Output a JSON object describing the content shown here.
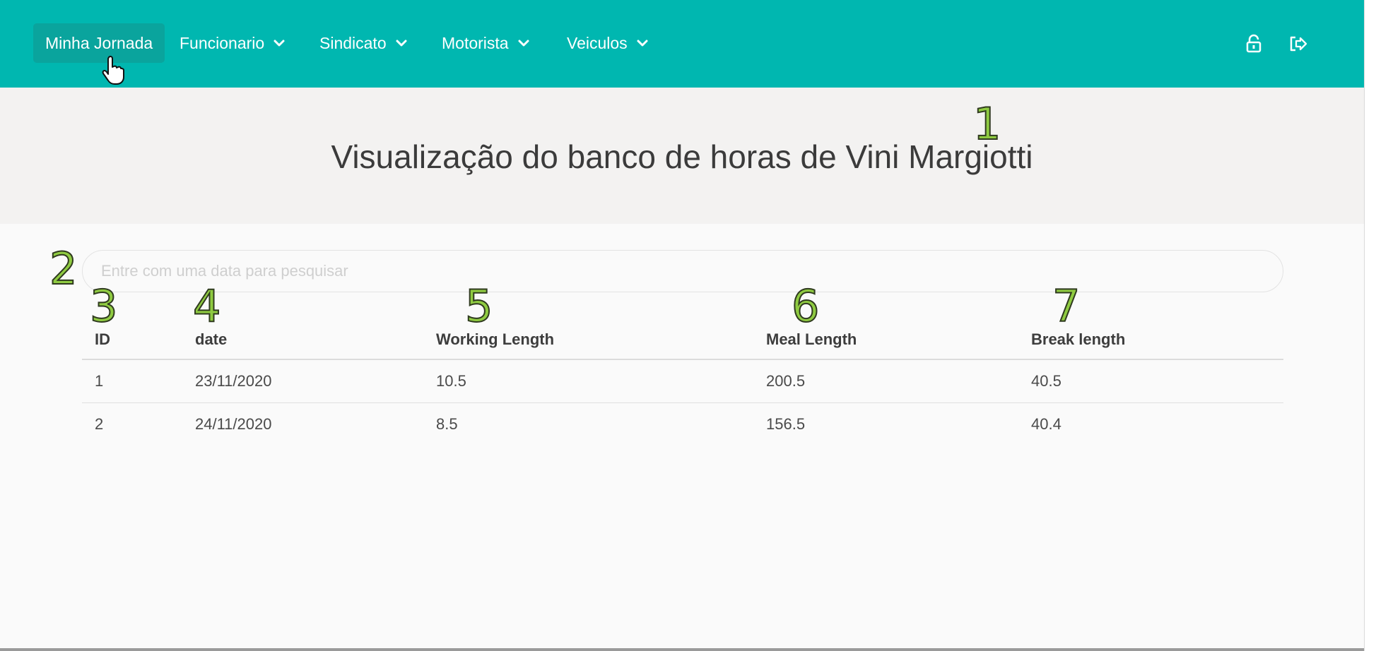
{
  "nav": {
    "items": [
      {
        "label": "Minha Jornada",
        "has_dropdown": false,
        "active": true
      },
      {
        "label": "Funcionario",
        "has_dropdown": true
      },
      {
        "label": "Sindicato",
        "has_dropdown": true
      },
      {
        "label": "Motorista",
        "has_dropdown": true
      },
      {
        "label": "Veiculos",
        "has_dropdown": true
      }
    ],
    "icons": [
      "lock-icon",
      "sign-out-icon"
    ]
  },
  "page": {
    "title": "Visualização do banco de horas de Vini Margiotti"
  },
  "search": {
    "placeholder": "Entre com uma data para pesquisar",
    "value": ""
  },
  "table": {
    "columns": [
      "ID",
      "date",
      "Working Length",
      "Meal Length",
      "Break length"
    ],
    "rows": [
      [
        "1",
        "23/11/2020",
        "10.5",
        "200.5",
        "40.5"
      ],
      [
        "2",
        "24/11/2020",
        "8.5",
        "156.5",
        "40.4"
      ]
    ]
  },
  "annotations": [
    "1",
    "2",
    "3",
    "4",
    "5",
    "6",
    "7"
  ],
  "colors": {
    "navbar": "#00b7b0",
    "nav_active": "#0aa49d",
    "hero_bg": "#f3f2f1",
    "marker": "#8fcb41"
  }
}
